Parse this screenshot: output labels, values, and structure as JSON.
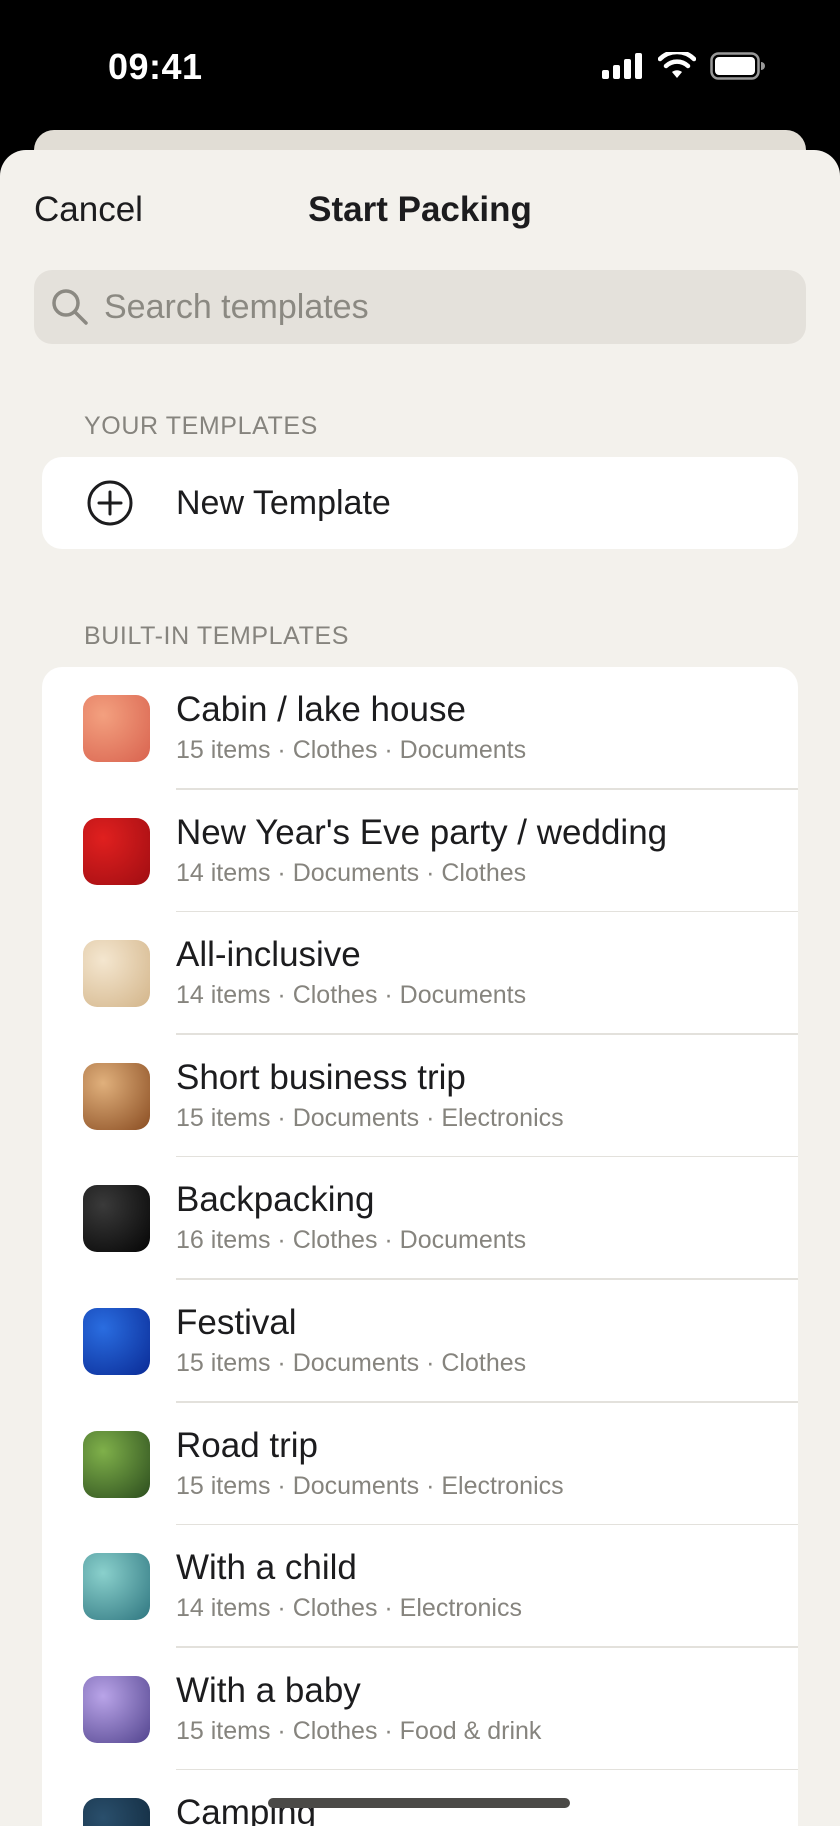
{
  "status_bar": {
    "time": "09:41"
  },
  "nav": {
    "cancel_label": "Cancel",
    "title": "Start Packing"
  },
  "search": {
    "placeholder": "Search templates",
    "value": ""
  },
  "your_templates": {
    "header": "YOUR TEMPLATES",
    "new_template_label": "New Template"
  },
  "built_in": {
    "header": "BUILT-IN TEMPLATES",
    "items": [
      {
        "title": "Cabin / lake house",
        "subtitle": "15 items · Clothes · Documents",
        "image": "pink sunset water texture",
        "color_a": "#f3a07f",
        "color_b": "#d9634f"
      },
      {
        "title": "New Year's Eve party / wedding",
        "subtitle": "14 items · Documents · Clothes",
        "image": "red sparkle texture",
        "color_a": "#e0201f",
        "color_b": "#a00d12"
      },
      {
        "title": "All-inclusive",
        "subtitle": "14 items · Clothes · Documents",
        "image": "wheat field",
        "color_a": "#f4e6cf",
        "color_b": "#d3b58a"
      },
      {
        "title": "Short business trip",
        "subtitle": "15 items · Documents · Electronics",
        "image": "brown marble swirl",
        "color_a": "#e0b07c",
        "color_b": "#8a4d22"
      },
      {
        "title": "Backpacking",
        "subtitle": "16 items · Clothes · Documents",
        "image": "black glossy",
        "color_a": "#3a3a3a",
        "color_b": "#050505"
      },
      {
        "title": "Festival",
        "subtitle": "15 items · Documents · Clothes",
        "image": "deep blue water",
        "color_a": "#2a6de0",
        "color_b": "#0a2b96"
      },
      {
        "title": "Road trip",
        "subtitle": "15 items · Documents · Electronics",
        "image": "green moss",
        "color_a": "#7fb04a",
        "color_b": "#2c4d1e"
      },
      {
        "title": "With a child",
        "subtitle": "14 items · Clothes · Electronics",
        "image": "teal swirl",
        "color_a": "#8ad0cc",
        "color_b": "#2f7680"
      },
      {
        "title": "With a baby",
        "subtitle": "15 items · Clothes · Food & drink",
        "image": "purple mountains",
        "color_a": "#b9a4e8",
        "color_b": "#52448e"
      },
      {
        "title": "Camping",
        "subtitle": "",
        "image": "dark blue texture",
        "color_a": "#2a4f6c",
        "color_b": "#10283c"
      }
    ]
  }
}
